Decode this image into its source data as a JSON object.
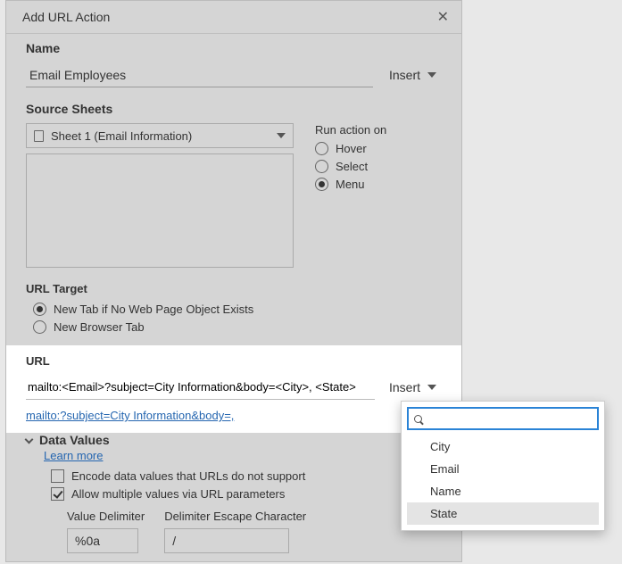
{
  "dialog": {
    "title": "Add URL Action"
  },
  "name_section": {
    "label": "Name",
    "value": "Email Employees",
    "insert_label": "Insert"
  },
  "source_sheets": {
    "label": "Source Sheets",
    "selected": "Sheet 1 (Email Information)",
    "run_on_label": "Run action on",
    "options": [
      {
        "label": "Hover",
        "selected": false
      },
      {
        "label": "Select",
        "selected": false
      },
      {
        "label": "Menu",
        "selected": true
      }
    ]
  },
  "url_target": {
    "label": "URL Target",
    "options": [
      {
        "label": "New Tab if No Web Page Object Exists",
        "selected": true
      },
      {
        "label": "New Browser Tab",
        "selected": false
      }
    ]
  },
  "url_section": {
    "label": "URL",
    "value": "mailto:<Email>?subject=City Information&body=<City>, <State>",
    "insert_label": "Insert",
    "preview_link": "mailto:?subject=City Information&body=,"
  },
  "data_values": {
    "heading": "Data Values",
    "learn_more": "Learn more",
    "encode_label": "Encode data values that URLs do not support",
    "encode_checked": false,
    "allow_multi_label": "Allow multiple values via URL parameters",
    "allow_multi_checked": true,
    "value_delim_label": "Value Delimiter",
    "value_delim": "%0a",
    "escape_label": "Delimiter Escape Character",
    "escape_value": "/"
  },
  "insert_menu": {
    "search": "",
    "items": [
      "City",
      "Email",
      "Name",
      "State"
    ],
    "highlighted": "State"
  }
}
